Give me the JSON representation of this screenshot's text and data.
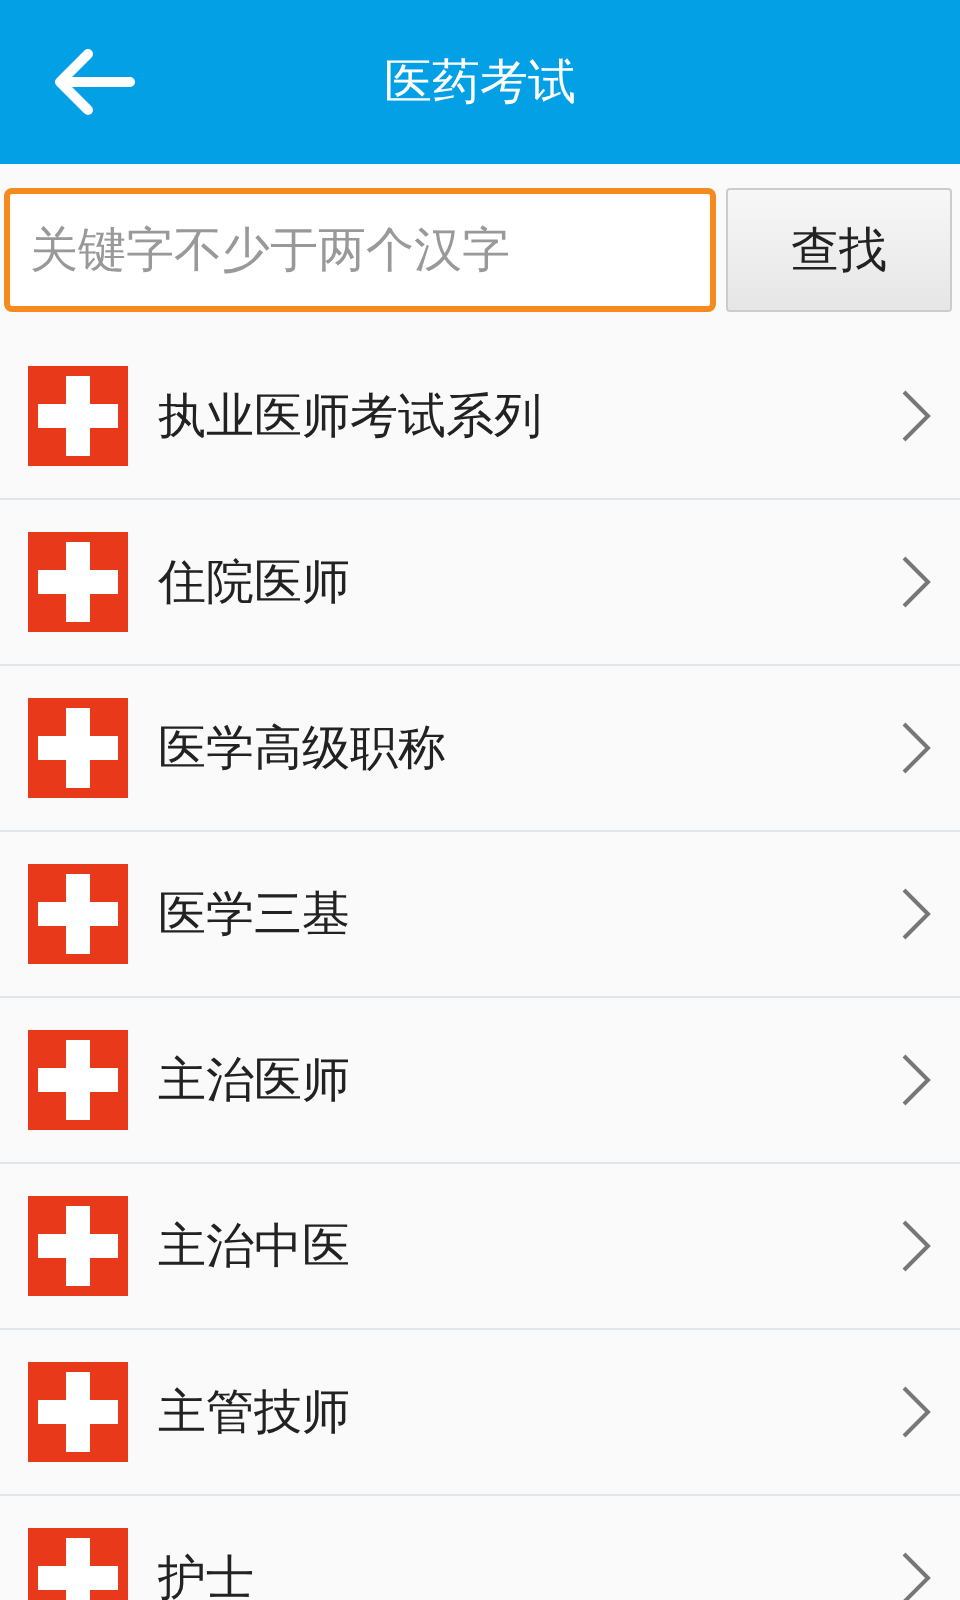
{
  "header": {
    "title": "医药考试"
  },
  "search": {
    "placeholder": "关键字不少于两个汉字",
    "button": "查找"
  },
  "items": [
    {
      "label": "执业医师考试系列"
    },
    {
      "label": "住院医师"
    },
    {
      "label": "医学高级职称"
    },
    {
      "label": "医学三基"
    },
    {
      "label": "主治医师"
    },
    {
      "label": "主治中医"
    },
    {
      "label": "主管技师"
    },
    {
      "label": "护士"
    }
  ]
}
